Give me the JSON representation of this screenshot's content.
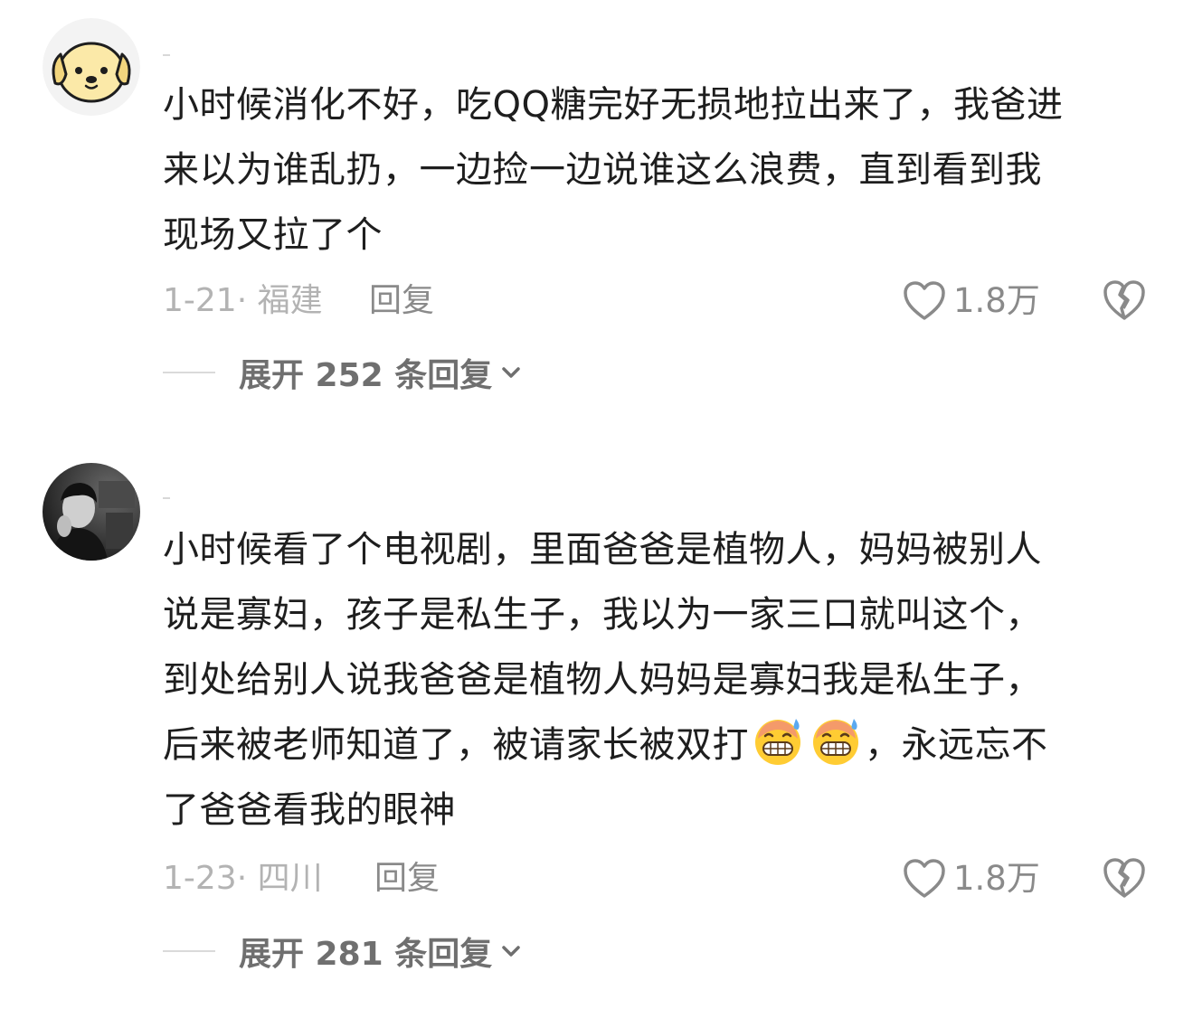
{
  "comments": [
    {
      "avatar_icon": "yellow-dog-avatar",
      "username": "",
      "text": "小时候消化不好，吃QQ糖完好无损地拉出来了，我爸进\n来以为谁乱扔，一边捡一边说谁这么浪费，直到看到我\n现场又拉了个",
      "date_location": "1-21· 福建",
      "reply_label": "回复",
      "like_count": "1.8万",
      "expand_label": "展开 252 条回复"
    },
    {
      "avatar_icon": "photo-avatar",
      "username": "",
      "text_before_emoji": "小时候看了个电视剧，里面爸爸是植物人，妈妈被别人\n说是寡妇，孩子是私生子，我以为一家三口就叫这个，\n到处给别人说我爸爸是植物人妈妈是寡妇我是私生子，\n后来被老师知道了，被请家长被双打",
      "emoji_icon": "grinning-sweat-emoji",
      "text_after_emoji": "，永远忘不\n了爸爸看我的眼神",
      "date_location": "1-23· 四川",
      "reply_label": "回复",
      "like_count": "1.8万",
      "expand_label": "展开 281 条回复"
    }
  ],
  "colors": {
    "text": "#1e1e1e",
    "meta": "#b3b3b3",
    "action": "#8a8a8a",
    "avatar_yellow": "#fbe9a8"
  }
}
